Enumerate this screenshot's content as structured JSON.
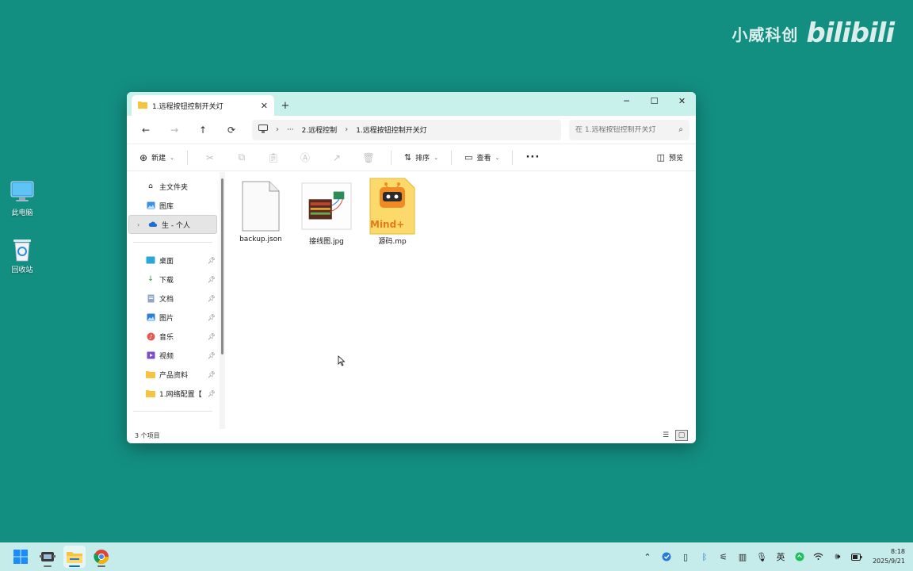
{
  "watermark": {
    "text": "小威科创",
    "logo": "bilibili"
  },
  "desktop": {
    "icons": [
      {
        "label": "此电脑",
        "icon": "monitor-icon"
      },
      {
        "label": "回收站",
        "icon": "recycle-bin-icon"
      }
    ]
  },
  "window": {
    "tab_title": "1.远程按钮控制开关灯",
    "new_tab": "+",
    "controls": {
      "minimize": "─",
      "maximize": "☐",
      "close": "✕"
    },
    "nav": {
      "back": "←",
      "forward": "→",
      "up": "↑",
      "refresh": "⟳"
    },
    "breadcrumb": {
      "more": "···",
      "items": [
        "2.远程控制",
        "1.远程按钮控制开关灯"
      ]
    },
    "search": {
      "placeholder": "在 1.远程按钮控制开关灯"
    },
    "toolbar": {
      "new_label": "新建",
      "sort_label": "排序",
      "view_label": "查看",
      "more": "···",
      "preview_label": "预览"
    },
    "navpane": {
      "top": [
        {
          "label": "主文件夹",
          "icon": "home-icon"
        },
        {
          "label": "图库",
          "icon": "gallery-icon"
        },
        {
          "label": "生 - 个人",
          "icon": "onedrive-icon",
          "selected": true
        }
      ],
      "pinned": [
        {
          "label": "桌面",
          "icon": "desktop-icon"
        },
        {
          "label": "下载",
          "icon": "download-icon"
        },
        {
          "label": "文档",
          "icon": "document-icon"
        },
        {
          "label": "图片",
          "icon": "pictures-icon"
        },
        {
          "label": "音乐",
          "icon": "music-icon"
        },
        {
          "label": "视频",
          "icon": "video-icon"
        },
        {
          "label": "产品资料",
          "icon": "folder-icon"
        },
        {
          "label": "1.网络配置【",
          "icon": "folder-icon"
        }
      ]
    },
    "files": [
      {
        "name": "backup.json",
        "icon": "json-file-icon"
      },
      {
        "name": "接线图.jpg",
        "icon": "image-file-icon"
      },
      {
        "name": "源码.mp",
        "icon": "mindplus-file-icon",
        "badge": "Mind+"
      }
    ],
    "status": {
      "count": "3 个项目"
    }
  },
  "taskbar": {
    "tray_ime": "英",
    "time": "8:18",
    "date": "2025/9/21"
  },
  "colors": {
    "desktop": "#138f82",
    "titlebar": "#c9f1ec",
    "taskbar": "#c5ecea",
    "accent": "#0a6ed1",
    "folder": "#f5c542"
  }
}
